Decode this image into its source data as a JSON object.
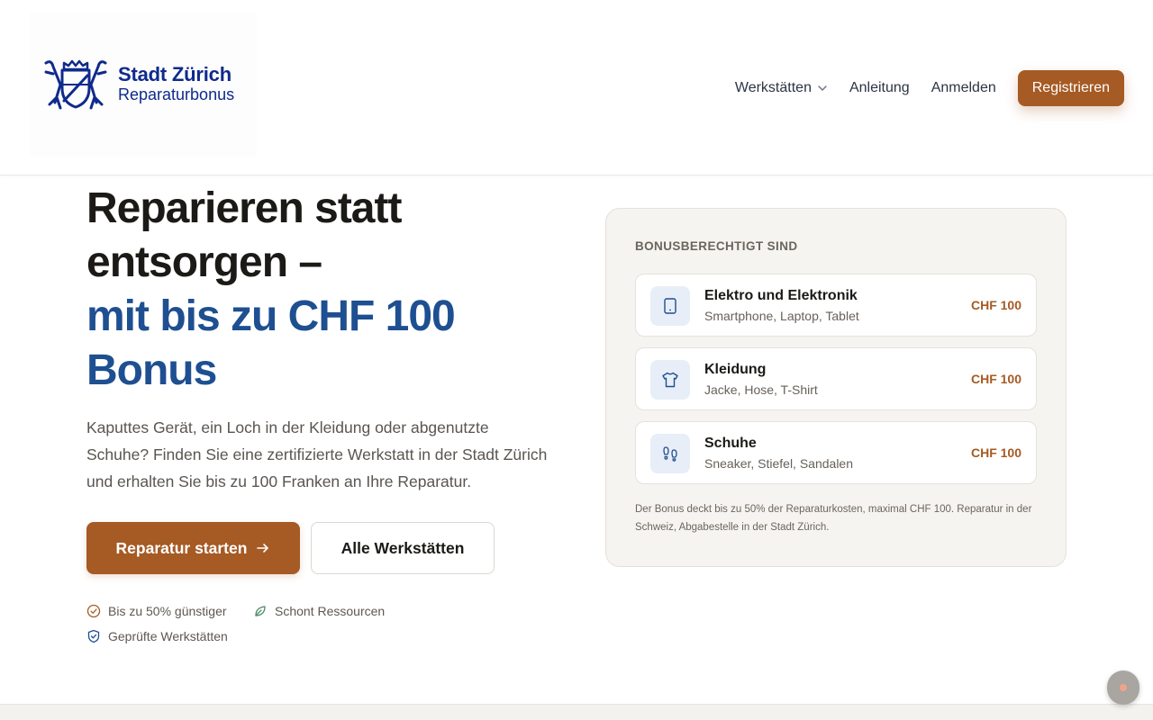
{
  "header": {
    "logo": {
      "title": "Stadt Zürich",
      "subtitle": "Reparaturbonus"
    },
    "nav": {
      "workshops": "Werkstätten",
      "guide": "Anleitung",
      "login": "Anmelden",
      "register": "Registrieren"
    }
  },
  "hero": {
    "title_line1": "Reparieren statt",
    "title_line2": "entsorgen –",
    "title_accent1": "mit bis zu CHF 100",
    "title_accent2": "Bonus",
    "description": "Kaputtes Gerät, ein Loch in der Kleidung oder abgenutzte Schuhe? Finden Sie eine zertifizierte Werkstatt in der Stadt Zürich und erhalten Sie bis zu 100 Franken an Ihre Reparatur.",
    "cta_primary": "Reparatur starten",
    "cta_secondary": "Alle Werkstätten",
    "features": [
      {
        "label": "Bis zu 50% günstiger",
        "icon": "check-circle-icon"
      },
      {
        "label": "Schont Ressourcen",
        "icon": "leaf-icon"
      },
      {
        "label": "Geprüfte Werkstätten",
        "icon": "shield-check-icon"
      }
    ]
  },
  "card": {
    "heading": "BONUSBERECHTIGT SIND",
    "items": [
      {
        "title": "Elektro und Elektronik",
        "subtitle": "Smartphone, Laptop, Tablet",
        "price": "CHF 100",
        "icon": "tablet-icon"
      },
      {
        "title": "Kleidung",
        "subtitle": "Jacke, Hose, T-Shirt",
        "price": "CHF 100",
        "icon": "shirt-icon"
      },
      {
        "title": "Schuhe",
        "subtitle": "Sneaker, Stiefel, Sandalen",
        "price": "CHF 100",
        "icon": "footprints-icon"
      }
    ],
    "note": "Der Bonus deckt bis zu 50% der Reparaturkosten, maximal CHF 100. Reparatur in der Schweiz, Abgabestelle in der Stadt Zürich."
  },
  "colors": {
    "brand_blue": "#0f2a8c",
    "accent_blue": "#1e4f91",
    "primary_brown": "#a65a24"
  }
}
